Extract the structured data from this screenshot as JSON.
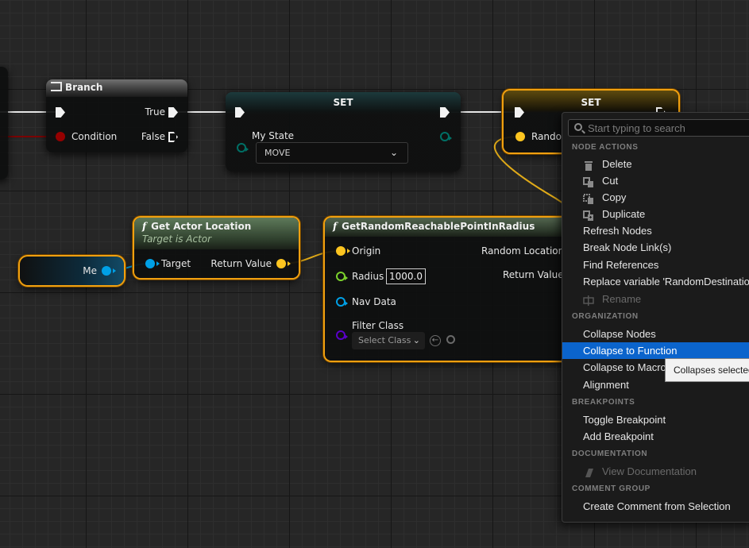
{
  "nodes": {
    "branch": {
      "title": "Branch",
      "true_label": "True",
      "false_label": "False",
      "condition_label": "Condition"
    },
    "set_state": {
      "title": "SET",
      "var_label": "My State",
      "value": "MOVE"
    },
    "set_random": {
      "title": "SET",
      "var_label": "Random"
    },
    "get_actor_location": {
      "title": "Get Actor Location",
      "subtitle": "Target is Actor",
      "target_label": "Target",
      "return_label": "Return Value"
    },
    "me": {
      "label": "Me"
    },
    "get_random_point": {
      "title": "GetRandomReachablePointInRadius",
      "origin_label": "Origin",
      "radius_label": "Radius",
      "radius_value": "1000.0",
      "nav_data_label": "Nav Data",
      "filter_class_label": "Filter Class",
      "select_class_label": "Select Class",
      "random_location_label": "Random Location",
      "return_label": "Return Value"
    }
  },
  "context_menu": {
    "search_placeholder": "Start typing to search",
    "sections": {
      "node_actions": "NODE ACTIONS",
      "organization": "ORGANIZATION",
      "breakpoints": "BREAKPOINTS",
      "documentation": "DOCUMENTATION",
      "comment_group": "COMMENT GROUP"
    },
    "items": {
      "delete": "Delete",
      "cut": "Cut",
      "copy": "Copy",
      "duplicate": "Duplicate",
      "refresh_nodes": "Refresh Nodes",
      "break_node_links": "Break Node Link(s)",
      "find_references": "Find References",
      "replace_variable": "Replace variable 'RandomDestination'",
      "rename": "Rename",
      "collapse_nodes": "Collapse Nodes",
      "collapse_to_function": "Collapse to Function",
      "collapse_to_macro": "Collapse to Macro",
      "alignment": "Alignment",
      "toggle_breakpoint": "Toggle Breakpoint",
      "add_breakpoint": "Add Breakpoint",
      "view_documentation": "View Documentation",
      "create_comment": "Create Comment from Selection"
    },
    "tooltip": "Collapses selected"
  },
  "colors": {
    "exec": "#f2f2f2",
    "bool_pin": "#950000",
    "byte_pin": "#006f65",
    "vector_pin": "#fdc520",
    "object_pin": "#00a0e6",
    "float_pin": "#7bd12c",
    "class_pin": "#5a00c8",
    "selection": "#f0a010",
    "menu_highlight": "#0b64cc"
  }
}
